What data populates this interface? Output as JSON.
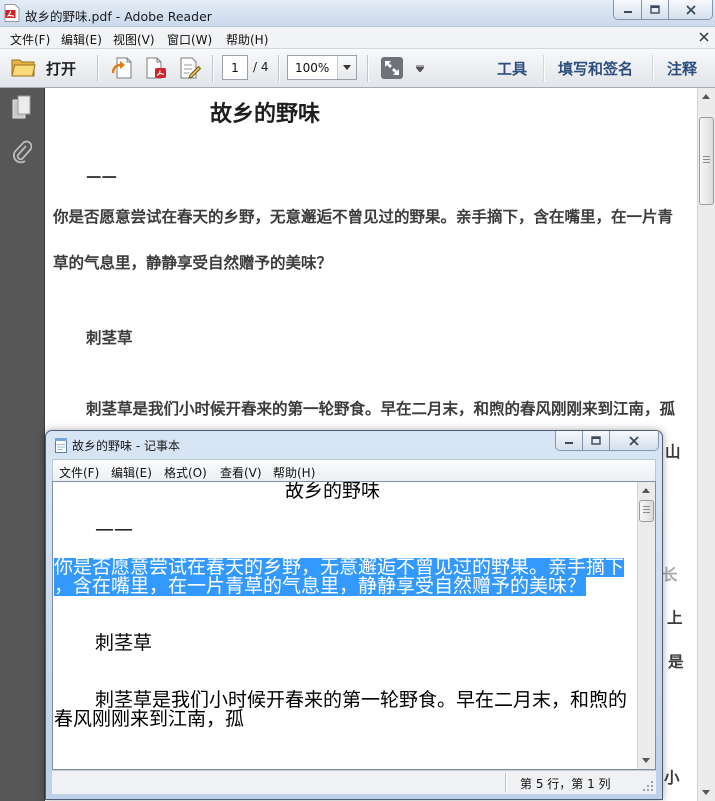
{
  "reader": {
    "title": "故乡的野味.pdf - Adobe Reader",
    "menu": [
      "文件(F)",
      "编辑(E)",
      "视图(V)",
      "窗口(W)",
      "帮助(H)"
    ],
    "toolbar": {
      "open_label": "打开",
      "page_current": "1",
      "page_total": "/ 4",
      "zoom": "100%",
      "tools": "工具",
      "fill_sign": "填写和签名",
      "comment": "注释"
    },
    "document": {
      "title": "故乡的野味",
      "dash": "——",
      "intro": [
        "你是否愿意尝试在春天的乡野，无意邂逅不曾见过的野果。亲手摘下，含在嘴里，在一片青",
        "草的气息里，静静享受自然赠予的美味？"
      ],
      "section_heading": "刺茎草",
      "section_text": [
        "刺茎草是我们小时候开春来的第一轮野食。早在二月末，和煦的春风刚刚来到江南，孤"
      ],
      "partially_visible": [
        "山",
        "长",
        "上",
        "是",
        "小"
      ]
    }
  },
  "notepad": {
    "title": "故乡的野味 - 记事本",
    "menu": [
      "文件(F)",
      "编辑(E)",
      "格式(O)",
      "查看(V)",
      "帮助(H)"
    ],
    "content": {
      "title": "故乡的野味",
      "dash": "——",
      "selected": [
        "你是否愿意尝试在春天的乡野，无意邂逅不曾见过的野果。亲手摘下",
        "，含在嘴里，在一片青草的气息里，静静享受自然赠予的美味？"
      ],
      "heading": "刺茎草",
      "body": [
        "刺茎草是我们小时候开春来的第一轮野食。早在二月末，和煦的",
        "春风刚刚来到江南，孤"
      ]
    },
    "status": "第 5 行，第 1 列"
  },
  "icons": {
    "reader_app": "pdf-file-icon",
    "open": "folder-icon",
    "toolbar": [
      "export-icon",
      "create-pdf-icon",
      "edit-document-icon",
      "fullscreen-icon"
    ],
    "nav_pane": [
      "page-thumbnails-icon",
      "attachments-icon"
    ],
    "notepad_app": "notepad-icon"
  },
  "colors": {
    "selection": "#3399ff",
    "toolbar_links": "#2e4f7d",
    "nav_pane": "#575757",
    "document_text": "#3c3c3c"
  }
}
